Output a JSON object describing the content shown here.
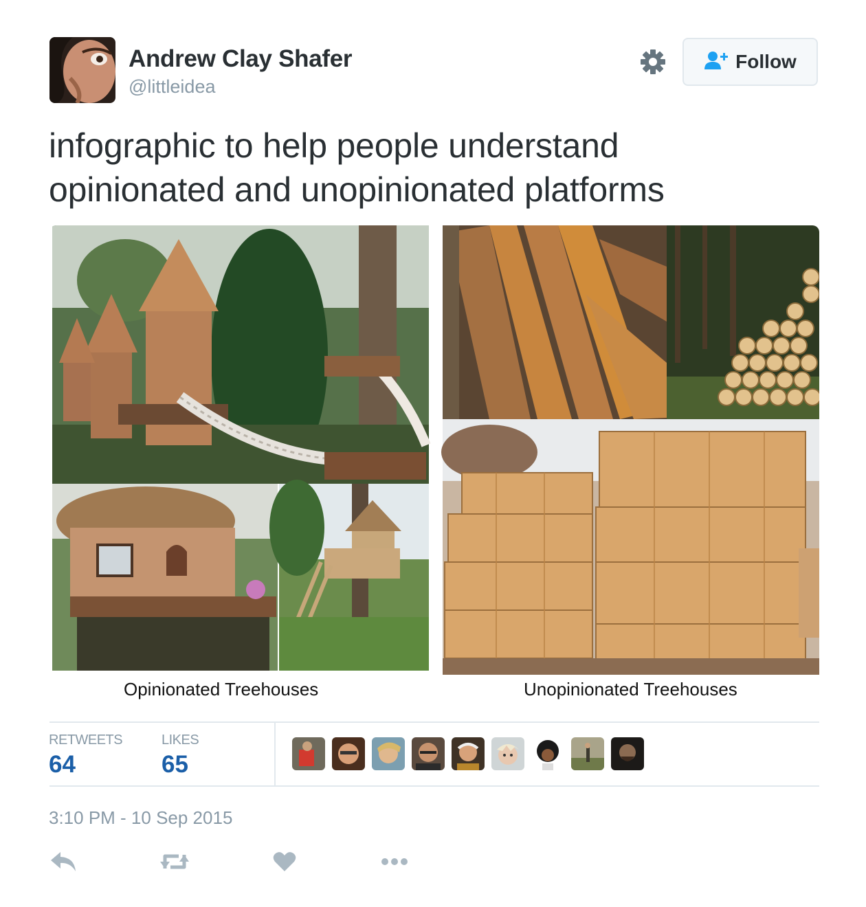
{
  "author": {
    "name": "Andrew Clay Shafer",
    "handle": "@littleidea"
  },
  "follow_button": {
    "label": "Follow",
    "icon": "add-user-icon"
  },
  "settings": {
    "icon": "gear-icon"
  },
  "tweet": {
    "line1": "infographic to help people understand",
    "line2": "opinionated and unopinionated platforms"
  },
  "media": {
    "left_caption": "Opinionated Treehouses",
    "right_caption": "Unopinionated Treehouses"
  },
  "stats": {
    "retweets_label": "RETWEETS",
    "retweets_value": "64",
    "likes_label": "LIKES",
    "likes_value": "65"
  },
  "timestamp": "3:10 PM - 10 Sep 2015",
  "actions": [
    "reply-icon",
    "retweet-icon",
    "like-icon",
    "more-icon"
  ],
  "colors": {
    "text": "#292f33",
    "muted": "#8899a6",
    "stat_value": "#1b5fa8",
    "divider": "#e1e8ed",
    "follow_icon": "#1da1f2"
  }
}
